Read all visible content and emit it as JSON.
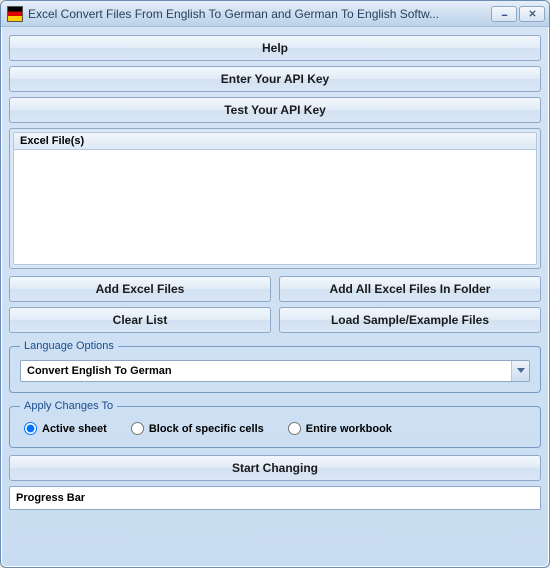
{
  "titlebar": {
    "title": "Excel Convert Files From English To German and German To English Softw..."
  },
  "buttons": {
    "help": "Help",
    "enter_api": "Enter Your API Key",
    "test_api": "Test Your API Key",
    "add_files": "Add Excel Files",
    "add_folder": "Add All Excel Files In Folder",
    "clear_list": "Clear List",
    "load_sample": "Load Sample/Example Files",
    "start": "Start Changing"
  },
  "file_section": {
    "header": "Excel File(s)"
  },
  "language": {
    "legend": "Language Options",
    "selected": "Convert English To German"
  },
  "apply": {
    "legend": "Apply Changes To",
    "options": {
      "active": "Active sheet",
      "block": "Block of specific cells",
      "entire": "Entire workbook"
    }
  },
  "progress": {
    "label": "Progress Bar"
  }
}
